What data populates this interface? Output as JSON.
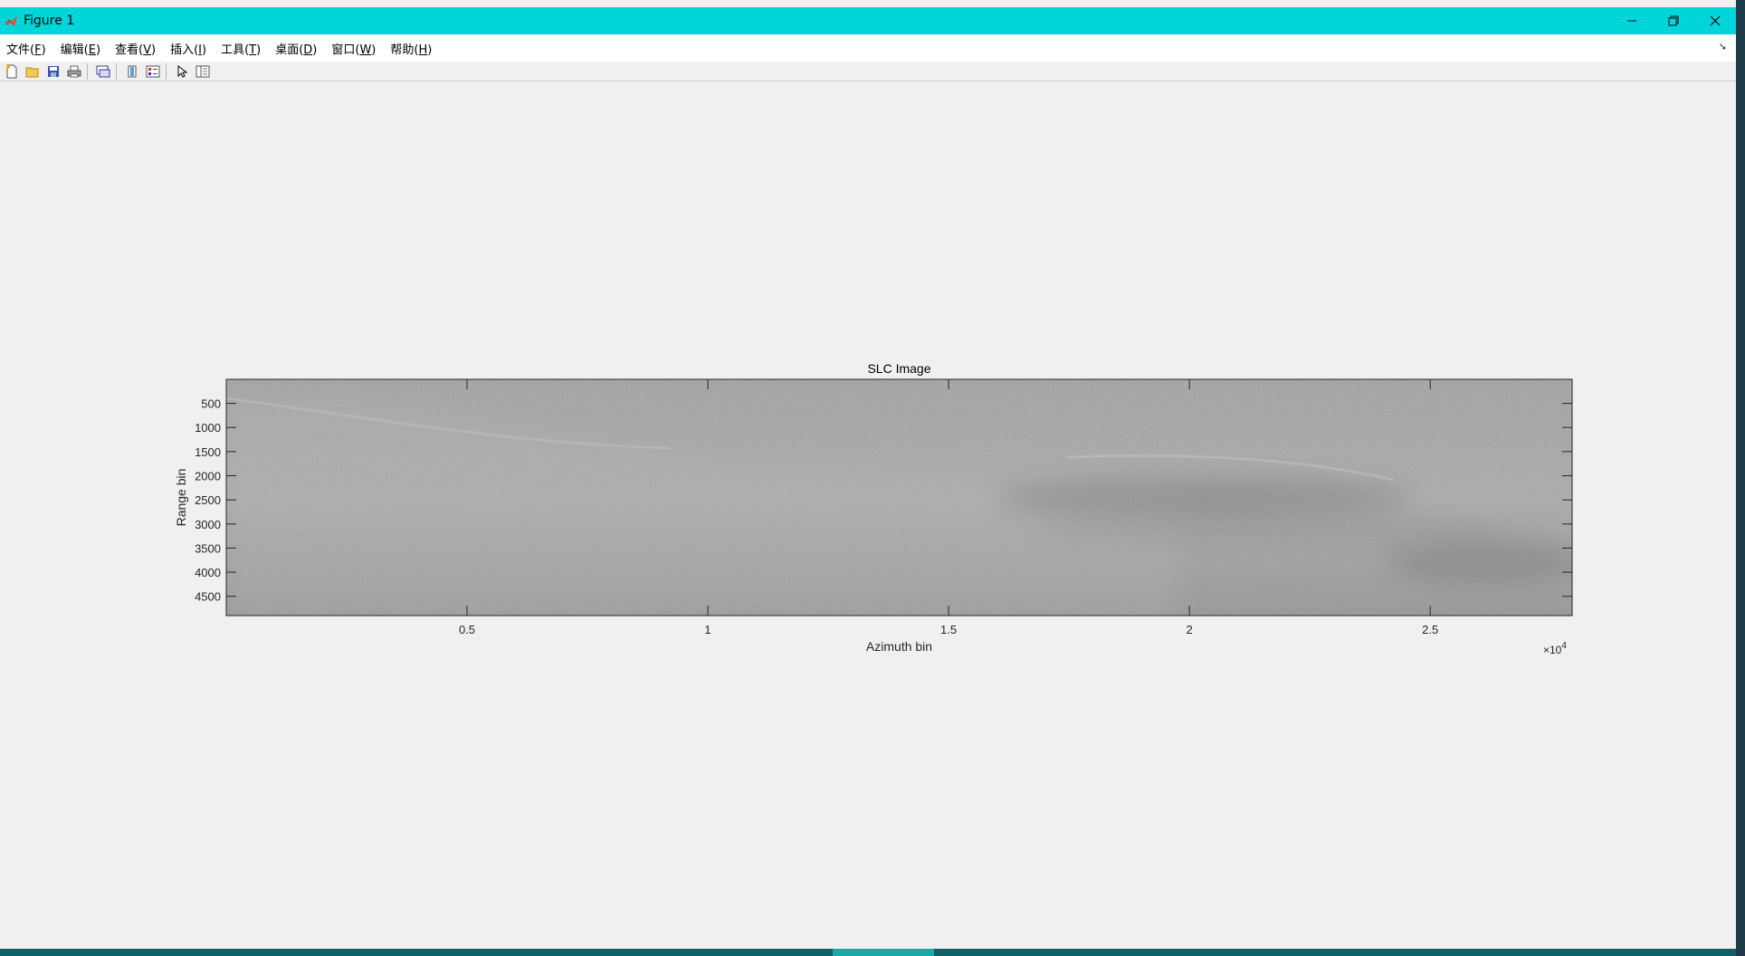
{
  "window": {
    "title": "Figure 1",
    "controls": [
      "minimize-icon",
      "restore-icon",
      "close-icon"
    ],
    "titlebar_color": "#00d5d9"
  },
  "menubar": {
    "items": [
      {
        "text": "文件",
        "accel": "(F)",
        "key": "F"
      },
      {
        "text": "编辑",
        "accel": "(E)",
        "key": "E"
      },
      {
        "text": "查看",
        "accel": "(V)",
        "key": "V"
      },
      {
        "text": "插入",
        "accel": "(I)",
        "key": "I"
      },
      {
        "text": "工具",
        "accel": "(T)",
        "key": "T"
      },
      {
        "text": "桌面",
        "accel": "(D)",
        "key": "D"
      },
      {
        "text": "窗口",
        "accel": "(W)",
        "key": "W"
      },
      {
        "text": "帮助",
        "accel": "(H)",
        "key": "H"
      }
    ]
  },
  "toolbar": {
    "buttons": [
      "new-figure-icon",
      "open-file-icon",
      "save-icon",
      "print-icon",
      "link-plot-icon",
      "colorbar-icon",
      "legend-icon",
      "pointer-icon",
      "property-inspector-icon"
    ]
  },
  "chart_data": {
    "type": "heatmap",
    "title": "SLC Image",
    "xlabel": "Azimuth bin",
    "ylabel": "Range bin",
    "x_exponent_label": "×10",
    "x_exponent_power": "4",
    "xlim": [
      1,
      27947
    ],
    "ylim": [
      1,
      4900
    ],
    "y_reversed": true,
    "xticks": [
      0.5,
      1,
      1.5,
      2,
      2.5
    ],
    "xtick_labels": [
      "0.5",
      "1",
      "1.5",
      "2",
      "2.5"
    ],
    "yticks": [
      500,
      1000,
      1500,
      2000,
      2500,
      3000,
      3500,
      4000,
      4500
    ],
    "ytick_labels": [
      "500",
      "1000",
      "1500",
      "2000",
      "2500",
      "3000",
      "3500",
      "4000",
      "4500"
    ],
    "colormap": "gray",
    "grid": false
  }
}
